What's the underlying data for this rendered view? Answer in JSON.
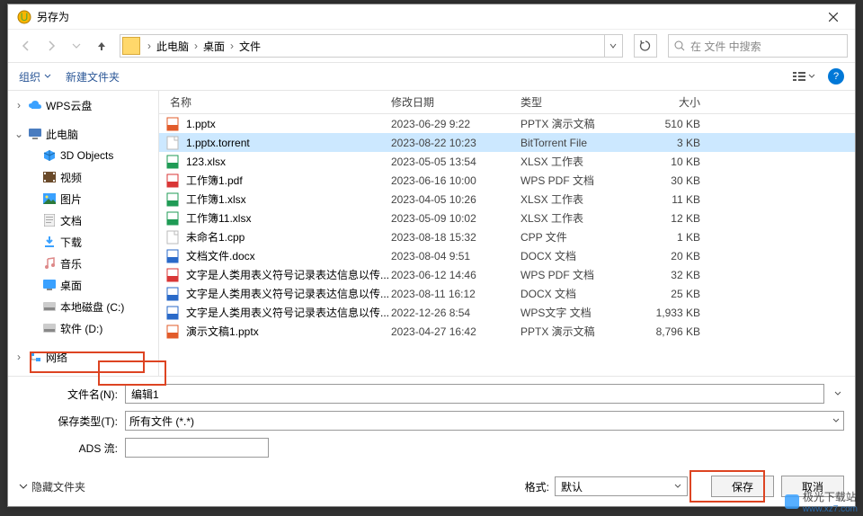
{
  "title": "另存为",
  "breadcrumb": {
    "items": [
      "此电脑",
      "桌面",
      "文件"
    ]
  },
  "search": {
    "placeholder": "在 文件 中搜索"
  },
  "toolbar": {
    "organize": "组织",
    "newfolder": "新建文件夹"
  },
  "columns": {
    "name": "名称",
    "date": "修改日期",
    "type": "类型",
    "size": "大小"
  },
  "sidebar": {
    "wps": "WPS云盘",
    "thispc": "此电脑",
    "objects3d": "3D Objects",
    "video": "视频",
    "pictures": "图片",
    "documents": "文档",
    "downloads": "下载",
    "music": "音乐",
    "desktop": "桌面",
    "localc": "本地磁盘 (C:)",
    "softd": "软件 (D:)",
    "network": "网络"
  },
  "files": [
    {
      "icon": "pptx",
      "name": "1.pptx",
      "date": "2023-06-29 9:22",
      "type": "PPTX 演示文稿",
      "size": "510 KB"
    },
    {
      "icon": "file",
      "name": "1.pptx.torrent",
      "date": "2023-08-22 10:23",
      "type": "BitTorrent File",
      "size": "3 KB",
      "selected": true
    },
    {
      "icon": "xlsx",
      "name": "123.xlsx",
      "date": "2023-05-05 13:54",
      "type": "XLSX 工作表",
      "size": "10 KB"
    },
    {
      "icon": "pdf",
      "name": "工作簿1.pdf",
      "date": "2023-06-16 10:00",
      "type": "WPS PDF 文档",
      "size": "30 KB"
    },
    {
      "icon": "xlsx",
      "name": "工作簿1.xlsx",
      "date": "2023-04-05 10:26",
      "type": "XLSX 工作表",
      "size": "11 KB"
    },
    {
      "icon": "xlsx",
      "name": "工作簿11.xlsx",
      "date": "2023-05-09 10:02",
      "type": "XLSX 工作表",
      "size": "12 KB"
    },
    {
      "icon": "file",
      "name": "未命名1.cpp",
      "date": "2023-08-18 15:32",
      "type": "CPP 文件",
      "size": "1 KB"
    },
    {
      "icon": "docx",
      "name": "文档文件.docx",
      "date": "2023-08-04 9:51",
      "type": "DOCX 文档",
      "size": "20 KB"
    },
    {
      "icon": "pdf",
      "name": "文字是人类用表义符号记录表达信息以传...",
      "date": "2023-06-12 14:46",
      "type": "WPS PDF 文档",
      "size": "32 KB"
    },
    {
      "icon": "docx",
      "name": "文字是人类用表义符号记录表达信息以传...",
      "date": "2023-08-11 16:12",
      "type": "DOCX 文档",
      "size": "25 KB"
    },
    {
      "icon": "wps",
      "name": "文字是人类用表义符号记录表达信息以传...",
      "date": "2022-12-26 8:54",
      "type": "WPS文字 文档",
      "size": "1,933 KB"
    },
    {
      "icon": "pptx",
      "name": "演示文稿1.pptx",
      "date": "2023-04-27 16:42",
      "type": "PPTX 演示文稿",
      "size": "8,796 KB"
    }
  ],
  "filename_label": "文件名(N):",
  "filename_value": "编辑1",
  "savetype_label": "保存类型(T):",
  "savetype_value": "所有文件 (*.*)",
  "ads_label": "ADS 流:",
  "hide_folders": "隐藏文件夹",
  "format_label": "格式:",
  "format_value": "默认",
  "save_btn": "保存",
  "cancel_btn": "取消",
  "watermark": {
    "text1": "极光下载站",
    "text2": "www.xz7.com"
  },
  "icon_colors": {
    "pptx": "#e25b2a",
    "xlsx": "#1f9b55",
    "pdf": "#d93636",
    "docx": "#2a6ac9",
    "wps": "#2a6ac9",
    "file": "#cfcfcf"
  }
}
